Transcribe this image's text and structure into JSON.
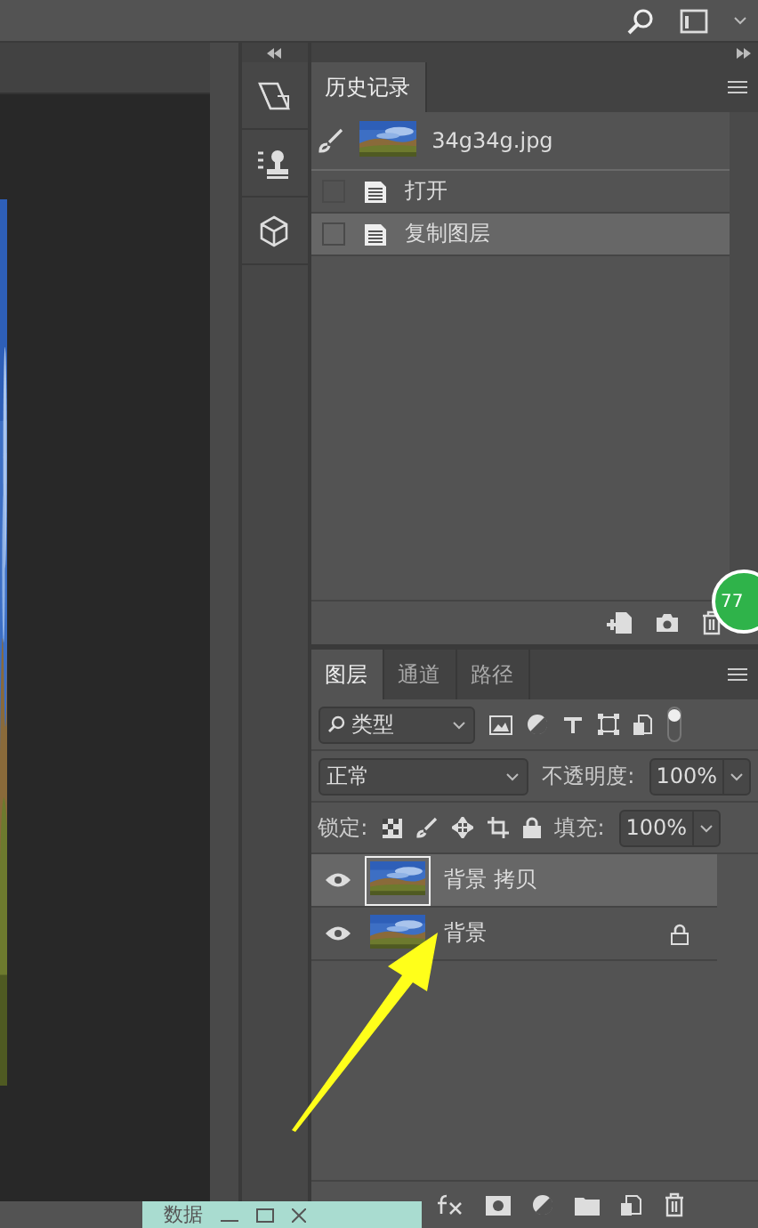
{
  "history_panel": {
    "tabs": [
      {
        "label": "历史记录",
        "selected": true
      }
    ],
    "snapshot": {
      "name": "34g34g.jpg"
    },
    "states": [
      {
        "label": "打开",
        "selected": false
      },
      {
        "label": "复制图层",
        "selected": true
      }
    ]
  },
  "badge": {
    "text": "77"
  },
  "layers_panel": {
    "tabs": [
      {
        "label": "图层",
        "selected": true
      },
      {
        "label": "通道",
        "selected": false
      },
      {
        "label": "路径",
        "selected": false
      }
    ],
    "filter": {
      "value": "类型"
    },
    "blend_mode": {
      "value": "正常"
    },
    "opacity": {
      "label": "不透明度:",
      "value": "100%"
    },
    "lock": {
      "label": "锁定:"
    },
    "fill": {
      "label": "填充:",
      "value": "100%"
    },
    "layers": [
      {
        "name": "背景 拷贝",
        "visible": true,
        "locked": false,
        "selected": true
      },
      {
        "name": "背景",
        "visible": true,
        "locked": true,
        "selected": false
      }
    ]
  },
  "bottom_window": {
    "title": "数据"
  }
}
